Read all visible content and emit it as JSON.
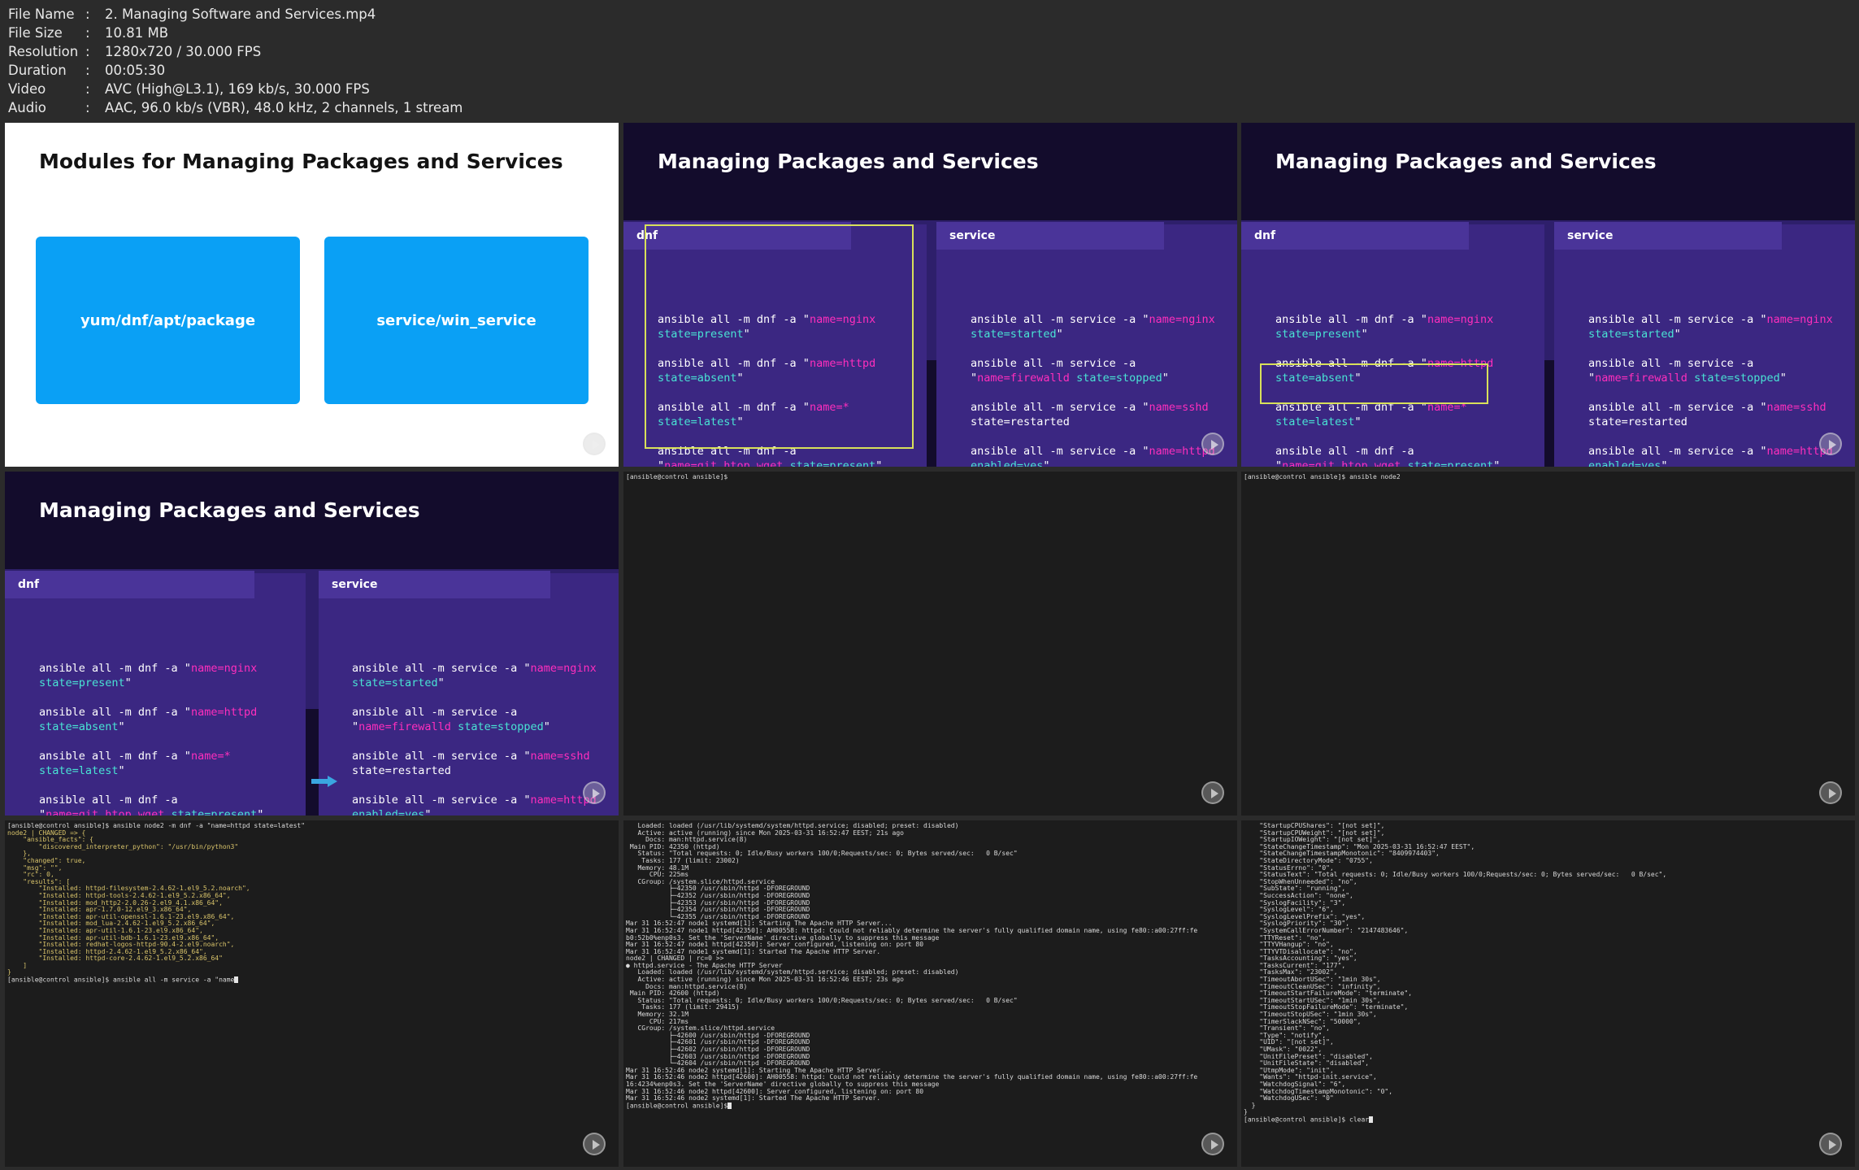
{
  "file_info": [
    {
      "key": "File Name",
      "value": "2. Managing Software and Services.mp4"
    },
    {
      "key": "File Size",
      "value": "10.81 MB"
    },
    {
      "key": "Resolution",
      "value": "1280x720 / 30.000 FPS"
    },
    {
      "key": "Duration",
      "value": "00:05:30"
    },
    {
      "key": "Video",
      "value": "AVC (High@L3.1), 169 kb/s, 30.000 FPS"
    },
    {
      "key": "Audio",
      "value": "AAC, 96.0 kb/s (VBR), 48.0 kHz, 2 channels, 1 stream"
    }
  ],
  "slide1": {
    "title": "Modules for Managing Packages and Services",
    "box_left": "yum/dnf/apt/package",
    "box_right": "service/win_service"
  },
  "slide_common": {
    "title": "Managing Packages and Services",
    "tab_dnf": "dnf",
    "tab_service": "service",
    "dnf_cmds": [
      {
        "a": "ansible all -m dnf -a \"",
        "b": "name=nginx",
        "c": "state=present",
        "d": "\""
      },
      {
        "a": "ansible all -m dnf -a \"",
        "b": "name=httpd",
        "c": "state=absent",
        "d": "\""
      },
      {
        "a": "ansible all -m dnf -a \"",
        "b": "name=*",
        "c": "state=latest",
        "d": "\""
      },
      {
        "a": "ansible all -m dnf -a",
        "b": "\"",
        "e": "name=git,htop,wget",
        "c": "state=present",
        "d": "\""
      }
    ],
    "svc_cmds": [
      {
        "a": "ansible all -m service -a \"",
        "b": "name=nginx",
        "c": "state=started",
        "d": "\""
      },
      {
        "a": "ansible all -m service -a",
        "b": "\"",
        "e": "name=firewalld",
        "c": "state=stopped",
        "d": "\""
      },
      {
        "a": "ansible all -m service -a \"",
        "b": "name=sshd",
        "c": "state=restarted",
        "d": ""
      },
      {
        "a": "ansible all -m service -a \"",
        "b": "name=httpd",
        "c": "enabled=yes",
        "d": "\""
      }
    ]
  },
  "term_prompt": "[ansible@control ansible]$",
  "term6_cmd": "ansible node2",
  "term7_lines": [
    "[ansible@control ansible]$ ansible node2 -m dnf -a \"name=httpd state=latest\"",
    "node2 | CHANGED => {",
    "    \"ansible_facts\": {",
    "        \"discovered_interpreter_python\": \"/usr/bin/python3\"",
    "    },",
    "    \"changed\": true,",
    "    \"msg\": \"\",",
    "    \"rc\": 0,",
    "    \"results\": [",
    "        \"Installed: httpd-filesystem-2.4.62-1.el9_5.2.noarch\",",
    "        \"Installed: httpd-tools-2.4.62-1.el9_5.2.x86_64\",",
    "        \"Installed: mod_http2-2.0.26-2.el9_4.1.x86_64\",",
    "        \"Installed: apr-1.7.0-12.el9_3.x86_64\",",
    "        \"Installed: apr-util-openssl-1.6.1-23.el9.x86_64\",",
    "        \"Installed: mod_lua-2.4.62-1.el9_5.2.x86_64\",",
    "        \"Installed: apr-util-1.6.1-23.el9.x86_64\",",
    "        \"Installed: apr-util-bdb-1.6.1-23.el9.x86_64\",",
    "        \"Installed: redhat-logos-httpd-90.4-2.el9.noarch\",",
    "        \"Installed: httpd-2.4.62-1.el9_5.2.x86_64\",",
    "        \"Installed: httpd-core-2.4.62-1.el9_5.2.x86_64\"",
    "    ]",
    "}"
  ],
  "term7_last": "[ansible@control ansible]$ ansible all -m service -a \"name",
  "term8_lines": [
    "   Loaded: loaded (/usr/lib/systemd/system/httpd.service; disabled; preset: disabled)",
    "   Active: active (running) since Mon 2025-03-31 16:52:47 EEST; 21s ago",
    "     Docs: man:httpd.service(8)",
    " Main PID: 42350 (httpd)",
    "   Status: \"Total requests: 0; Idle/Busy workers 100/0;Requests/sec: 0; Bytes served/sec:   0 B/sec\"",
    "    Tasks: 177 (limit: 23002)",
    "   Memory: 48.1M",
    "      CPU: 225ms",
    "   CGroup: /system.slice/httpd.service",
    "           ├─42350 /usr/sbin/httpd -DFOREGROUND",
    "           ├─42352 /usr/sbin/httpd -DFOREGROUND",
    "           ├─42353 /usr/sbin/httpd -DFOREGROUND",
    "           ├─42354 /usr/sbin/httpd -DFOREGROUND",
    "           └─42355 /usr/sbin/httpd -DFOREGROUND",
    "",
    "Mar 31 16:52:47 node1 systemd[1]: Starting The Apache HTTP Server...",
    "Mar 31 16:52:47 node1 httpd[42350]: AH00558: httpd: Could not reliably determine the server's fully qualified domain name, using fe80::a00:27ff:fe",
    "b0:52b0%enp0s3. Set the 'ServerName' directive globally to suppress this message",
    "Mar 31 16:52:47 node1 httpd[42350]: Server configured, listening on: port 80",
    "Mar 31 16:52:47 node1 systemd[1]: Started The Apache HTTP Server.",
    "node2 | CHANGED | rc=0 >>",
    "● httpd.service - The Apache HTTP Server",
    "   Loaded: loaded (/usr/lib/systemd/system/httpd.service; disabled; preset: disabled)",
    "   Active: active (running) since Mon 2025-03-31 16:52:46 EEST; 23s ago",
    "     Docs: man:httpd.service(8)",
    " Main PID: 42600 (httpd)",
    "   Status: \"Total requests: 0; Idle/Busy workers 100/0;Requests/sec: 0; Bytes served/sec:   0 B/sec\"",
    "    Tasks: 177 (limit: 29415)",
    "   Memory: 32.1M",
    "      CPU: 217ms",
    "   CGroup: /system.slice/httpd.service",
    "           ├─42600 /usr/sbin/httpd -DFOREGROUND",
    "           ├─42601 /usr/sbin/httpd -DFOREGROUND",
    "           ├─42602 /usr/sbin/httpd -DFOREGROUND",
    "           ├─42603 /usr/sbin/httpd -DFOREGROUND",
    "           └─42604 /usr/sbin/httpd -DFOREGROUND",
    "",
    "Mar 31 16:52:46 node2 systemd[1]: Starting The Apache HTTP Server...",
    "Mar 31 16:52:46 node2 httpd[42600]: AH00558: httpd: Could not reliably determine the server's fully qualified domain name, using fe80::a00:27ff:fe",
    "16:4234%enp0s3. Set the 'ServerName' directive globally to suppress this message",
    "Mar 31 16:52:46 node2 httpd[42600]: Server configured, listening on: port 80",
    "Mar 31 16:52:46 node2 systemd[1]: Started The Apache HTTP Server."
  ],
  "term9_lines": [
    "    \"StartupCPUShares\": \"[not set]\",",
    "    \"StartupCPUWeight\": \"[not set]\",",
    "    \"StartupIOWeight\": \"[not set]\",",
    "    \"StateChangeTimestamp\": \"Mon 2025-03-31 16:52:47 EEST\",",
    "    \"StateChangeTimestampMonotonic\": \"8409974403\",",
    "    \"StateDirectoryMode\": \"0755\",",
    "    \"StatusErrno\": \"0\",",
    "    \"StatusText\": \"Total requests: 0; Idle/Busy workers 100/0;Requests/sec: 0; Bytes served/sec:   0 B/sec\",",
    "    \"StopWhenUnneeded\": \"no\",",
    "    \"SubState\": \"running\",",
    "    \"SuccessAction\": \"none\",",
    "    \"SyslogFacility\": \"3\",",
    "    \"SyslogLevel\": \"6\",",
    "    \"SyslogLevelPrefix\": \"yes\",",
    "    \"SyslogPriority\": \"30\",",
    "    \"SystemCallErrorNumber\": \"2147483646\",",
    "    \"TTYReset\": \"no\",",
    "    \"TTYVHangup\": \"no\",",
    "    \"TTYVTDisallocate\": \"no\",",
    "    \"TasksAccounting\": \"yes\",",
    "    \"TasksCurrent\": \"177\",",
    "    \"TasksMax\": \"23002\",",
    "    \"TimeoutAbortUSec\": \"1min 30s\",",
    "    \"TimeoutCleanUSec\": \"infinity\",",
    "    \"TimeoutStartFailureMode\": \"terminate\",",
    "    \"TimeoutStartUSec\": \"1min 30s\",",
    "    \"TimeoutStopFailureMode\": \"terminate\",",
    "    \"TimeoutStopUSec\": \"1min 30s\",",
    "    \"TimerSlackNSec\": \"50000\",",
    "    \"Transient\": \"no\",",
    "    \"Type\": \"notify\",",
    "    \"UID\": \"[not set]\",",
    "    \"UMask\": \"0022\",",
    "    \"UnitFilePreset\": \"disabled\",",
    "    \"UnitFileState\": \"disabled\",",
    "    \"UtmpMode\": \"init\",",
    "    \"Wants\": \"httpd-init.service\",",
    "    \"WatchdogSignal\": \"6\",",
    "    \"WatchdogTimestampMonotonic\": \"0\",",
    "    \"WatchdogUSec\": \"0\"",
    "  }",
    "}"
  ],
  "term9_last": "[ansible@control ansible]$ clear",
  "colors": {
    "pink": "#ff2ebd",
    "teal": "#49e3d4",
    "highlight": "#d8e05a",
    "blue": "#0aa0f5"
  }
}
